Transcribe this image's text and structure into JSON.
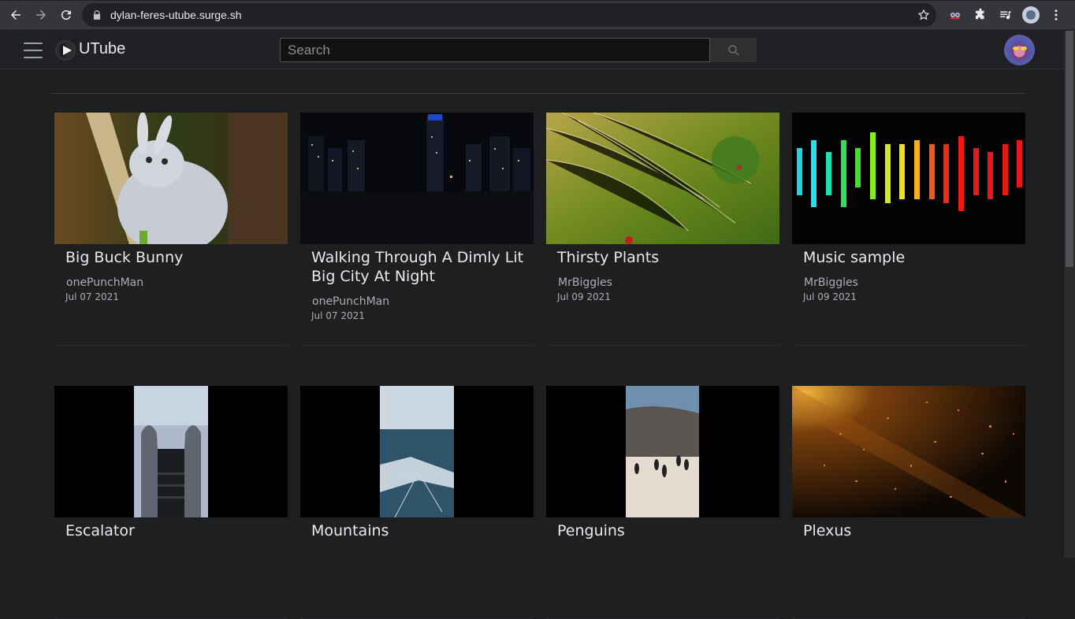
{
  "browser": {
    "url": "dylan-feres-utube.surge.sh"
  },
  "app": {
    "brand": "UTube",
    "search_placeholder": "Search"
  },
  "videos": [
    {
      "title": "Big Buck Bunny",
      "channel": "onePunchMan",
      "date": "Jul 07 2021"
    },
    {
      "title": "Walking Through A Dimly Lit Big City At Night",
      "channel": "onePunchMan",
      "date": "Jul 07 2021"
    },
    {
      "title": "Thirsty Plants",
      "channel": "MrBiggles",
      "date": "Jul 09 2021"
    },
    {
      "title": "Music sample",
      "channel": "MrBiggles",
      "date": "Jul 09 2021"
    },
    {
      "title": "Escalator",
      "channel": "",
      "date": ""
    },
    {
      "title": "Mountains",
      "channel": "",
      "date": ""
    },
    {
      "title": "Penguins",
      "channel": "",
      "date": ""
    },
    {
      "title": "Plexus",
      "channel": "",
      "date": ""
    }
  ]
}
